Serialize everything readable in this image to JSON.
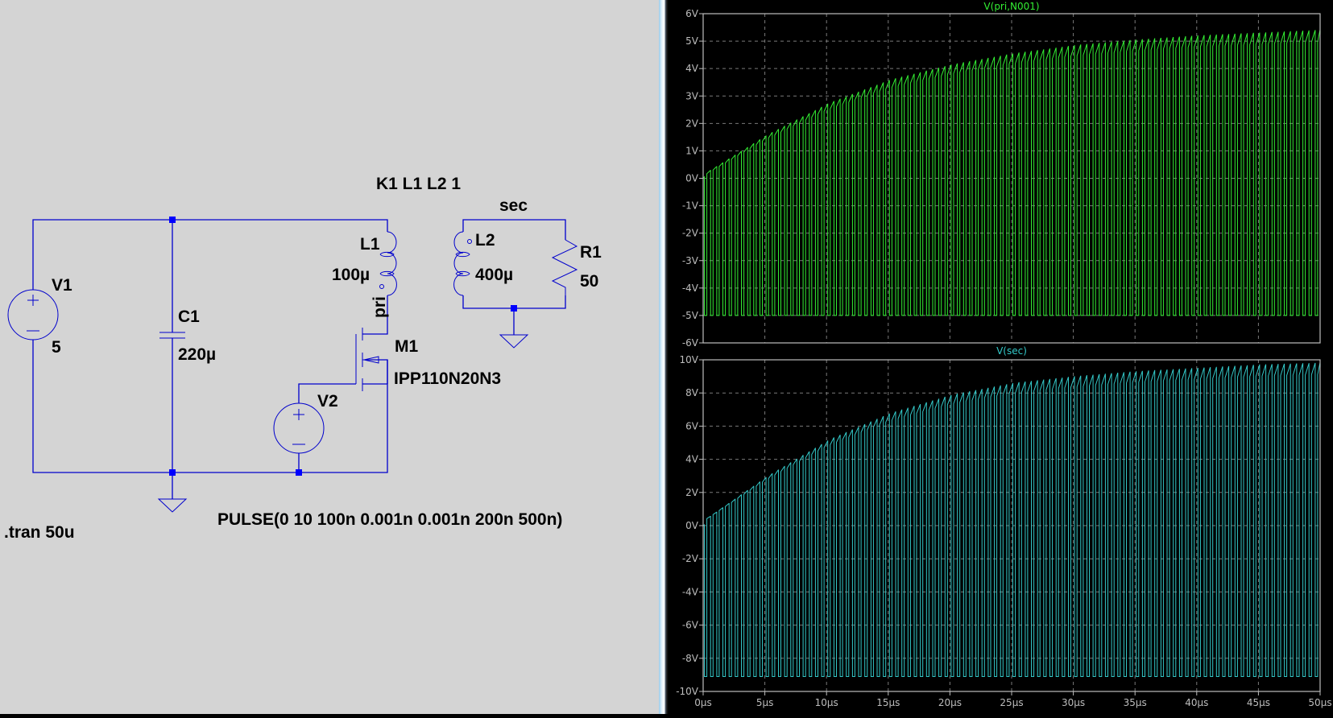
{
  "schematic": {
    "directive_coupling": "K1 L1 L2 1",
    "net_sec": "sec",
    "net_pri": "pri",
    "L1": {
      "name": "L1",
      "value": "100µ"
    },
    "L2": {
      "name": "L2",
      "value": "400µ"
    },
    "R1": {
      "name": "R1",
      "value": "50"
    },
    "V1": {
      "name": "V1",
      "value": "5"
    },
    "C1": {
      "name": "C1",
      "value": "220µ"
    },
    "M1": {
      "name": "M1",
      "model": "IPP110N20N3"
    },
    "V2": {
      "name": "V2",
      "value": "PULSE(0 10 100n 0.001n 0.001n 200n 500n)"
    },
    "tran": ".tran 50u",
    "wire_color": "#0000cc",
    "node_color": "#0000ff"
  },
  "chart_data": [
    {
      "type": "line",
      "title": "V(pri,N001)",
      "color": "#33ee33",
      "ylim": [
        -6,
        6
      ],
      "yticks": [
        "6V",
        "5V",
        "4V",
        "3V",
        "2V",
        "1V",
        "0V",
        "-1V",
        "-2V",
        "-3V",
        "-4V",
        "-5V",
        "-6V"
      ],
      "ytick_values": [
        6,
        5,
        4,
        3,
        2,
        1,
        0,
        -1,
        -2,
        -3,
        -4,
        -5,
        -6
      ],
      "xlim": [
        0,
        50
      ],
      "xunit": "µs",
      "grid": true,
      "pulse_period_us": 0.5,
      "low_level": -5.0,
      "envelope_t_us": [
        0,
        5,
        10,
        15,
        20,
        25,
        30,
        35,
        40,
        45,
        50
      ],
      "envelope_peak": [
        0.2,
        1.6,
        2.75,
        3.6,
        4.15,
        4.55,
        4.85,
        5.05,
        5.2,
        5.3,
        5.4
      ]
    },
    {
      "type": "line",
      "title": "V(sec)",
      "color": "#33c8c8",
      "ylim": [
        -10,
        10
      ],
      "yticks": [
        "10V",
        "8V",
        "6V",
        "4V",
        "2V",
        "0V",
        "-2V",
        "-4V",
        "-6V",
        "-8V",
        "-10V"
      ],
      "ytick_values": [
        10,
        8,
        6,
        4,
        2,
        0,
        -2,
        -4,
        -6,
        -8,
        -10
      ],
      "xlim": [
        0,
        50
      ],
      "xticks": [
        "0µs",
        "5µs",
        "10µs",
        "15µs",
        "20µs",
        "25µs",
        "30µs",
        "35µs",
        "40µs",
        "45µs",
        "50µs"
      ],
      "xtick_values": [
        0,
        5,
        10,
        15,
        20,
        25,
        30,
        35,
        40,
        45,
        50
      ],
      "grid": true,
      "pulse_period_us": 0.5,
      "low_level": -9.1,
      "envelope_t_us": [
        0,
        5,
        10,
        15,
        20,
        25,
        30,
        35,
        40,
        45,
        50
      ],
      "envelope_peak": [
        0.4,
        3.0,
        5.2,
        6.8,
        7.9,
        8.6,
        9.0,
        9.3,
        9.5,
        9.7,
        9.8
      ]
    }
  ]
}
